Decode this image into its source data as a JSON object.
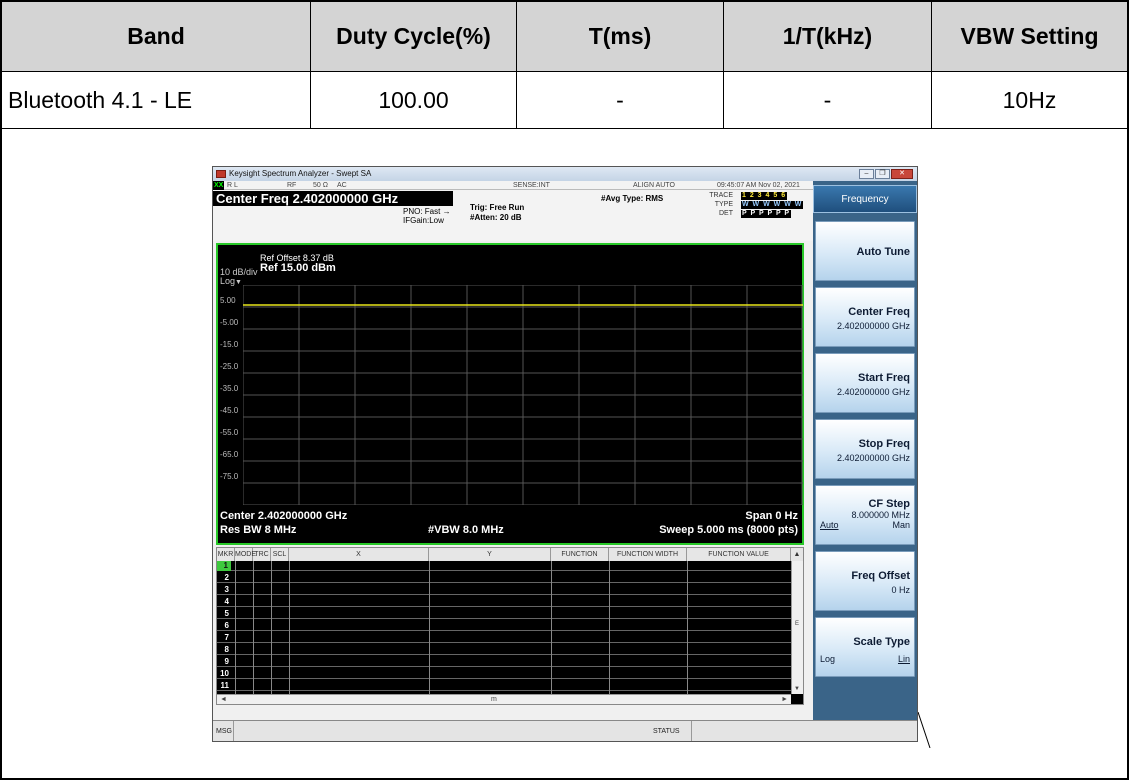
{
  "table": {
    "headers": [
      "Band",
      "Duty Cycle(%)",
      "T(ms)",
      "1/T(kHz)",
      "VBW Setting"
    ],
    "row": [
      "Bluetooth 4.1 - LE",
      "100.00",
      "-",
      "-",
      "10Hz"
    ]
  },
  "analyzer": {
    "window_title": "Keysight Spectrum Analyzer - Swept SA",
    "status_top": {
      "xx": "XX",
      "rl": "R L",
      "rf": "RF",
      "impedance": "50 Ω",
      "coupling": "AC",
      "sense": "SENSE:INT",
      "align": "ALIGN AUTO",
      "datetime": "09:45:07 AM Nov 02, 2021"
    },
    "center_freq_header": "Center Freq 2.402000000 GHz",
    "pno": "PNO: Fast",
    "ifgain": "IFGain:Low",
    "trig": "Trig: Free Run",
    "atten": "#Atten: 20 dB",
    "avg_type": "#Avg Type: RMS",
    "trace_labels": {
      "trace": "TRACE",
      "type": "TYPE",
      "det": "DET"
    },
    "trace_values": {
      "trace": "1 2 3 4 5 6",
      "type": "W W W W W W",
      "det": "P P P P P P"
    },
    "plot": {
      "ref_offset": "Ref Offset 8.37 dB",
      "scale": "10 dB/div",
      "ref_level": "Ref 15.00 dBm",
      "log": "Log",
      "y_labels": [
        "5.00",
        "-5.00",
        "-15.0",
        "-25.0",
        "-35.0",
        "-45.0",
        "-55.0",
        "-65.0",
        "-75.0"
      ],
      "center": "Center 2.402000000 GHz",
      "span": "Span 0 Hz",
      "res_bw": "Res BW 8 MHz",
      "vbw": "#VBW 8.0 MHz",
      "sweep": "Sweep  5.000 ms (8000 pts)",
      "trace_color": "#e8e61a"
    },
    "marker_table": {
      "headers": [
        "MKR",
        "MODE",
        "TRC",
        "SCL",
        "X",
        "Y",
        "FUNCTION",
        "FUNCTION WIDTH",
        "FUNCTION VALUE"
      ],
      "rows": [
        "1",
        "2",
        "3",
        "4",
        "5",
        "6",
        "7",
        "8",
        "9",
        "10",
        "11"
      ],
      "scroll_mark": "m",
      "side_mark": "E"
    },
    "msg_bar": {
      "msg": "MSG",
      "status": "STATUS"
    },
    "softkeys": {
      "title": "Frequency",
      "auto_tune": "Auto Tune",
      "center_freq": {
        "label": "Center Freq",
        "value": "2.402000000 GHz"
      },
      "start_freq": {
        "label": "Start Freq",
        "value": "2.402000000 GHz"
      },
      "stop_freq": {
        "label": "Stop Freq",
        "value": "2.402000000 GHz"
      },
      "cf_step": {
        "label": "CF Step",
        "value": "8.000000 MHz",
        "auto": "Auto",
        "man": "Man"
      },
      "freq_offset": {
        "label": "Freq Offset",
        "value": "0 Hz"
      },
      "scale_type": {
        "label": "Scale Type",
        "log": "Log",
        "lin": "Lin"
      }
    }
  }
}
